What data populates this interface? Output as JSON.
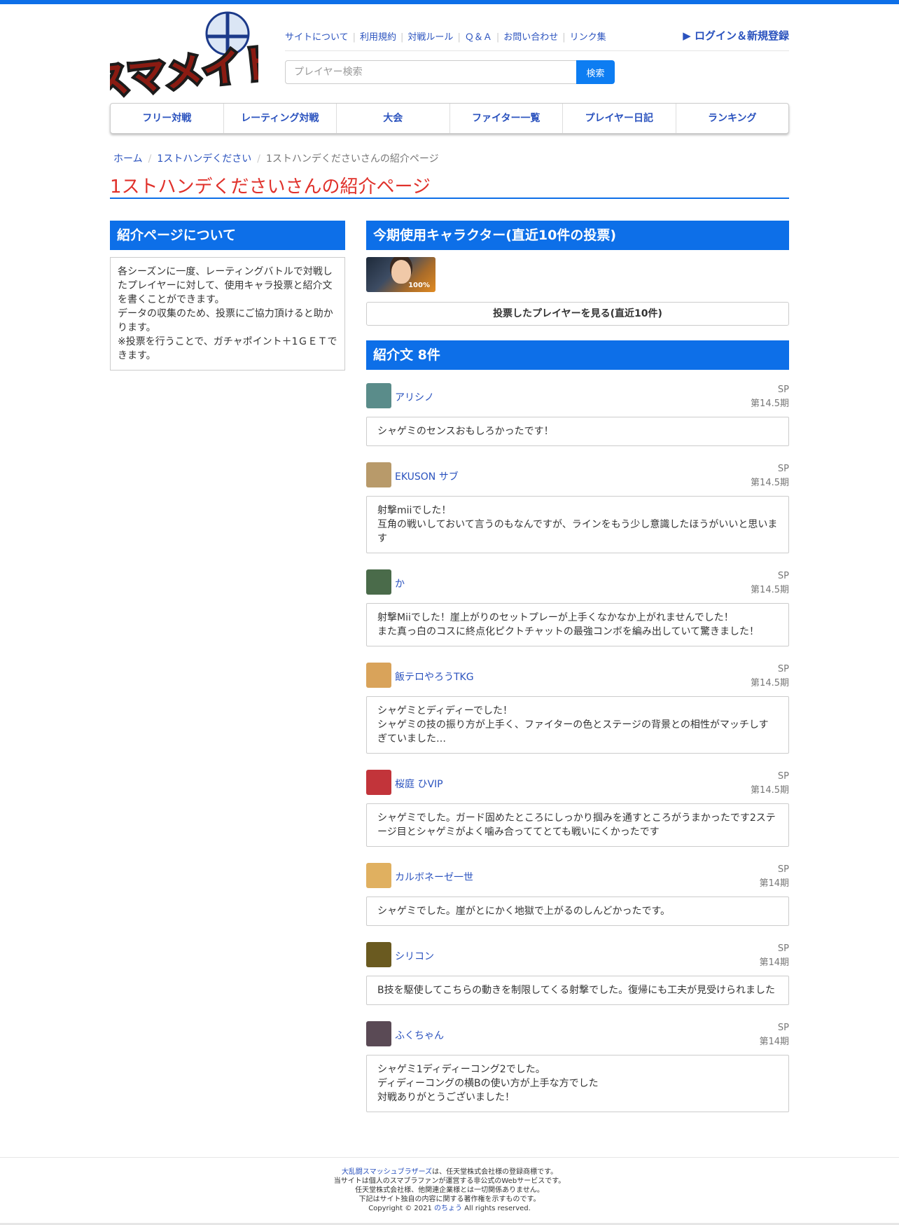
{
  "site": {
    "logo_text": "スマメイト",
    "top_links": [
      "サイトについて",
      "利用規約",
      "対戦ルール",
      "Ｑ＆Ａ",
      "お問い合わせ",
      "リンク集"
    ],
    "login": "▶ ログイン＆新規登録",
    "search_placeholder": "プレイヤー検索",
    "search_button": "検索"
  },
  "nav": [
    "フリー対戦",
    "レーティング対戦",
    "大会",
    "ファイター一覧",
    "プレイヤー日記",
    "ランキング"
  ],
  "breadcrumb": [
    "ホーム",
    "1ストハンデください",
    "1ストハンデくださいさんの紹介ページ"
  ],
  "page_title": "1ストハンデくださいさんの紹介ページ",
  "about": {
    "heading": "紹介ページについて",
    "lines": [
      "各シーズンに一度、レーティングバトルで対戦したプレイヤーに対して、使用キャラ投票と紹介文を書くことができます。",
      "データの収集のため、投票にご協力頂けると助かります。",
      "※投票を行うことで、ガチャポイント＋1ＧＥＴできます。"
    ]
  },
  "characters": {
    "heading": "今期使用キャラクター(直近10件の投票)",
    "percent": "100%",
    "vote_button": "投票したプレイヤーを見る(直近10件)"
  },
  "reviews_heading": "紹介文 8件",
  "reviews": [
    {
      "name": "アリシノ",
      "game": "SP",
      "season": "第14.5期",
      "lines": [
        "シャゲミのセンスおもしろかったです！"
      ],
      "avatar_color": "#5a8c8a"
    },
    {
      "name": "EKUSON サブ",
      "game": "SP",
      "season": "第14.5期",
      "lines": [
        "射撃miiでした！",
        "互角の戦いしておいて言うのもなんですが、ラインをもう少し意識したほうがいいと思います"
      ],
      "avatar_color": "#b89a6a"
    },
    {
      "name": "か",
      "game": "SP",
      "season": "第14.5期",
      "lines": [
        "射撃Miiでした！崖上がりのセットプレーが上手くなかなか上がれませんでした！",
        "また真っ白のコスに終点化ピクトチャットの最強コンボを編み出していて驚きました！"
      ],
      "avatar_color": "#4a6b4a"
    },
    {
      "name": "飯テロやろうTKG",
      "game": "SP",
      "season": "第14.5期",
      "lines": [
        "シャゲミとディディーでした！",
        "シャゲミの技の振り方が上手く、ファイターの色とステージの背景との相性がマッチしすぎていました…"
      ],
      "avatar_color": "#d9a35a"
    },
    {
      "name": "桜庭 ひVIP",
      "game": "SP",
      "season": "第14.5期",
      "lines": [
        "シャゲミでした。ガード固めたところにしっかり掴みを通すところがうまかったです2ステージ目とシャゲミがよく噛み合っててとても戦いにくかったです"
      ],
      "avatar_color": "#c2343a"
    },
    {
      "name": "カルボネーゼ一世",
      "game": "SP",
      "season": "第14期",
      "lines": [
        "シャゲミでした。崖がとにかく地獄で上がるのしんどかったです。"
      ],
      "avatar_color": "#e0b060"
    },
    {
      "name": "シリコン",
      "game": "SP",
      "season": "第14期",
      "lines": [
        "B技を駆使してこちらの動きを制限してくる射撃でした。復帰にも工夫が見受けられました"
      ],
      "avatar_color": "#6a5a20"
    },
    {
      "name": "ふくちゃん",
      "game": "SP",
      "season": "第14期",
      "lines": [
        "シャゲミ1ディディーコング2でした。",
        "ディディーコングの横Bの使い方が上手な方でした",
        "対戦ありがとうございました！"
      ],
      "avatar_color": "#5a4a55"
    }
  ],
  "footer": [
    {
      "link": "大乱闘スマッシュブラザーズ",
      "text": "は、任天堂株式会社様の登録商標です。"
    },
    {
      "link": "",
      "text": "当サイトは個人のスマブラファンが運営する非公式のWebサービスです。"
    },
    {
      "link": "",
      "text": "任天堂株式会社様、他関連企業様とは一切関係ありません。"
    },
    {
      "link": "",
      "text": "下記はサイト独自の内容に関する著作権を示すものです。"
    }
  ],
  "copyright": {
    "prefix": "Copyright © 2021 ",
    "link": "のちょう",
    "suffix": " All rights reserved."
  }
}
